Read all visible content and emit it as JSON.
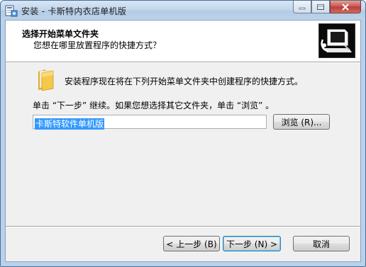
{
  "window": {
    "title": "安装 - 卡斯特内衣店单机版",
    "controls": [
      "minimize-icon",
      "maximize-icon",
      "close-icon"
    ]
  },
  "header": {
    "title": "选择开始菜单文件夹",
    "subtitle": "您想在哪里放置程序的快捷方式？"
  },
  "body": {
    "instruction": "安装程序现在将在下列开始菜单文件夹中创建程序的快捷方式。",
    "hint": "单击 “下一步” 继续。如果您想选择其它文件夹，单击 “浏览” 。",
    "folder_value": "卡斯特软件单机版",
    "browse_label": "浏览 (R)..."
  },
  "footer": {
    "back_label": "< 上一步 (B)",
    "next_label": "下一步 (N) >",
    "cancel_label": "取消"
  },
  "colors": {
    "selection": "#3399ff",
    "titlebar": "#c3d7ec",
    "client": "#f0f0f0"
  }
}
